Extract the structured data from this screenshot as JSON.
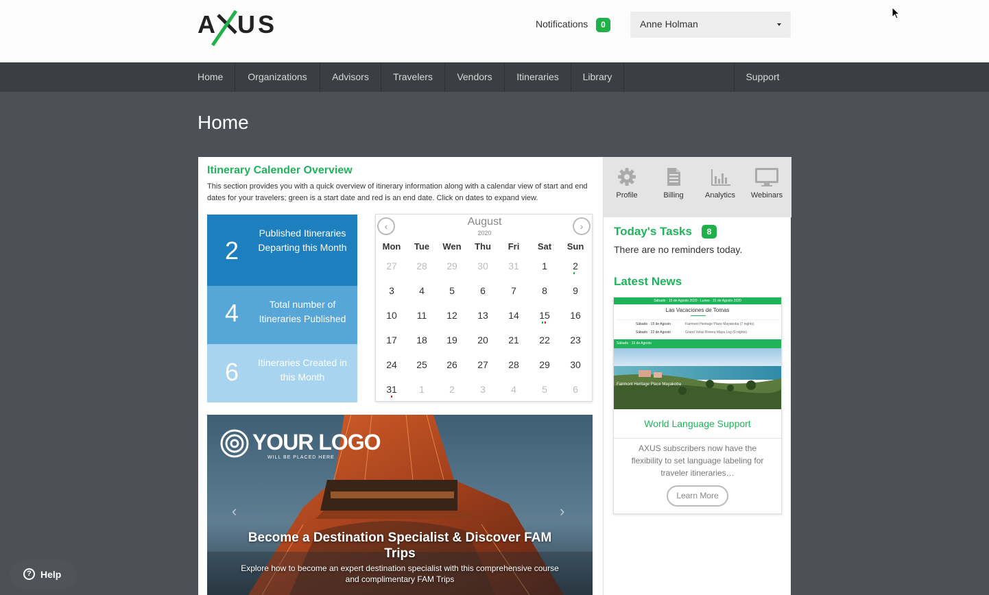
{
  "header": {
    "logo_text": "AXUS",
    "notifications_label": "Notifications",
    "notifications_count": "0",
    "user_name": "Anne Holman"
  },
  "nav": {
    "items": [
      "Home",
      "Organizations",
      "Advisors",
      "Travelers",
      "Vendors",
      "Itineraries",
      "Library"
    ],
    "support": "Support"
  },
  "page": {
    "title": "Home"
  },
  "overview": {
    "title": "Itinerary Calender Overview",
    "description": "This section provides you with a quick overview of itinerary information along with a calendar view of start and end dates for your travelers; green is a start date and red is an end date. Click on dates to expand view.",
    "stats": [
      {
        "value": "2",
        "label": "Published Itineraries Departing this Month",
        "color": "#1e7fbf"
      },
      {
        "value": "4",
        "label": "Total number of Itineraries Published",
        "color": "#56a6d8"
      },
      {
        "value": "6",
        "label": "Itineraries Created in this Month",
        "color": "#a9d4ef"
      }
    ]
  },
  "calendar": {
    "month": "August",
    "year": "2020",
    "weekdays": [
      "Mon",
      "Tue",
      "Wen",
      "Thu",
      "Fri",
      "Sat",
      "Sun"
    ],
    "weeks": [
      [
        [
          "27",
          "muted"
        ],
        [
          "28",
          "muted"
        ],
        [
          "29",
          "muted"
        ],
        [
          "30",
          "muted"
        ],
        [
          "31",
          "muted"
        ],
        [
          "1",
          ""
        ],
        [
          "2",
          "start"
        ]
      ],
      [
        [
          "3",
          ""
        ],
        [
          "4",
          ""
        ],
        [
          "5",
          ""
        ],
        [
          "6",
          ""
        ],
        [
          "7",
          ""
        ],
        [
          "8",
          ""
        ],
        [
          "9",
          ""
        ]
      ],
      [
        [
          "10",
          ""
        ],
        [
          "11",
          ""
        ],
        [
          "12",
          ""
        ],
        [
          "13",
          ""
        ],
        [
          "14",
          ""
        ],
        [
          "15",
          "both"
        ],
        [
          "16",
          ""
        ]
      ],
      [
        [
          "17",
          ""
        ],
        [
          "18",
          ""
        ],
        [
          "19",
          ""
        ],
        [
          "20",
          ""
        ],
        [
          "21",
          ""
        ],
        [
          "22",
          ""
        ],
        [
          "23",
          ""
        ]
      ],
      [
        [
          "24",
          ""
        ],
        [
          "25",
          ""
        ],
        [
          "26",
          ""
        ],
        [
          "27",
          ""
        ],
        [
          "28",
          ""
        ],
        [
          "29",
          ""
        ],
        [
          "30",
          ""
        ]
      ],
      [
        [
          "31",
          "end"
        ],
        [
          "1",
          "muted"
        ],
        [
          "2",
          "muted"
        ],
        [
          "3",
          "muted"
        ],
        [
          "4",
          "muted"
        ],
        [
          "5",
          "muted"
        ],
        [
          "6",
          "muted"
        ]
      ]
    ],
    "start_color": "#22b04b",
    "end_color": "#e02020"
  },
  "tools": [
    {
      "label": "Profile",
      "icon": "gear-icon"
    },
    {
      "label": "Billing",
      "icon": "document-icon"
    },
    {
      "label": "Analytics",
      "icon": "bar-chart-icon"
    },
    {
      "label": "Webinars",
      "icon": "monitor-icon"
    }
  ],
  "tasks": {
    "title": "Today's Tasks",
    "count": "8",
    "text": "There are no reminders today."
  },
  "news": {
    "title": "Latest News",
    "card": {
      "img_header": "Sábado · 15 de Agosto 2020 - Lunes · 31 de Agosto 2020",
      "img_title": "Las Vacaciones de Tomas",
      "img_rows": [
        [
          "Sábado · 15 de Agosto",
          "Fairmont Heritage Place Mayakoba (7 nights)"
        ],
        [
          "Sábado · 22 de Agosto",
          "Grand Velas Riviera Maya Leg (9 nights)"
        ]
      ],
      "img_section": "Sábado · 15 de Agosto",
      "img_caption": "Fairmont Heritage Place Mayakoba",
      "headline": "World Language Support",
      "body": "AXUS subscribers now have the flexibility to set language labeling for traveler itineraries…",
      "button": "Learn More"
    }
  },
  "banner": {
    "logo_text": "YOUR LOGO",
    "logo_sub": "WILL BE PLACED HERE",
    "headline": "Become a Destination Specialist & Discover FAM Trips",
    "sub": "Explore how to become an expert destination specialist with this comprehensive course and complimentary FAM Trips"
  },
  "help": {
    "label": "Help"
  },
  "colors": {
    "brand_green": "#1fb35a",
    "nav_bg": "#3b3e42",
    "page_bg": "#4d5157"
  }
}
